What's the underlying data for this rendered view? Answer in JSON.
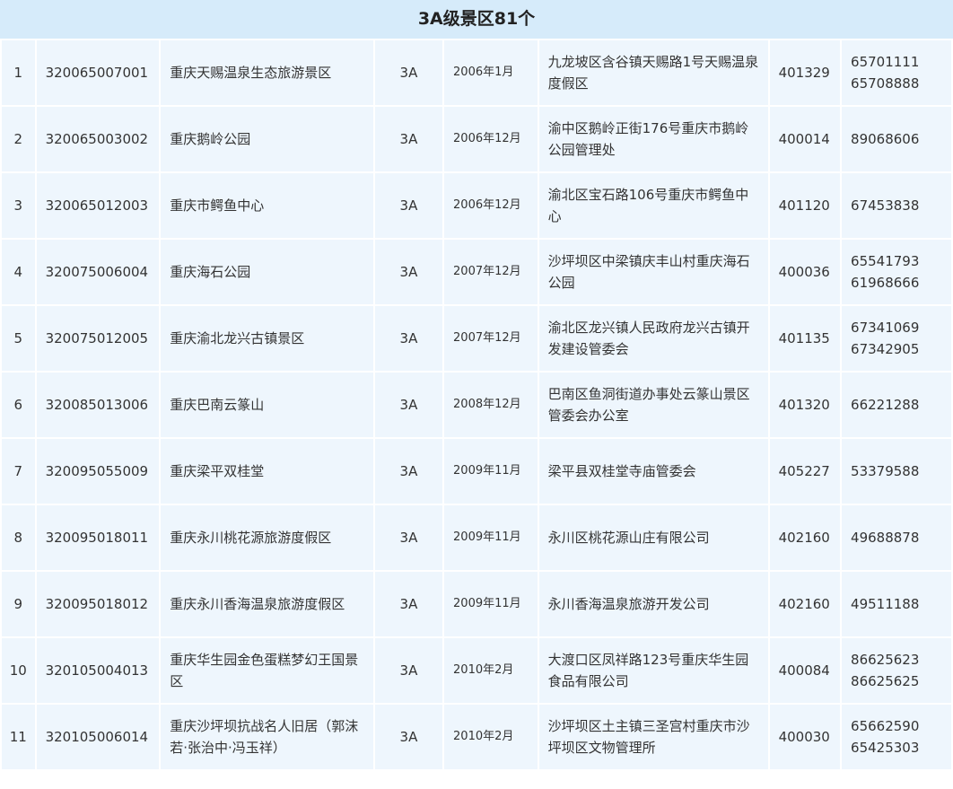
{
  "title": "3A级景区81个",
  "rows": [
    {
      "no": "1",
      "code": "320065007001",
      "name": "重庆天赐温泉生态旅游景区",
      "level": "3A",
      "date": "2006年1月",
      "address": "九龙坡区含谷镇天赐路1号天赐温泉度假区",
      "zip": "401329",
      "phone": "65701111 65708888"
    },
    {
      "no": "2",
      "code": "320065003002",
      "name": "重庆鹅岭公园",
      "level": "3A",
      "date": "2006年12月",
      "address": "渝中区鹅岭正街176号重庆市鹅岭公园管理处",
      "zip": "400014",
      "phone": "89068606"
    },
    {
      "no": "3",
      "code": "320065012003",
      "name": "重庆市鳄鱼中心",
      "level": "3A",
      "date": "2006年12月",
      "address": "渝北区宝石路106号重庆市鳄鱼中心",
      "zip": "401120",
      "phone": "67453838"
    },
    {
      "no": "4",
      "code": "320075006004",
      "name": "重庆海石公园",
      "level": "3A",
      "date": "2007年12月",
      "address": "沙坪坝区中梁镇庆丰山村重庆海石公园",
      "zip": "400036",
      "phone": "65541793 61968666"
    },
    {
      "no": "5",
      "code": "320075012005",
      "name": "重庆渝北龙兴古镇景区",
      "level": "3A",
      "date": "2007年12月",
      "address": "渝北区龙兴镇人民政府龙兴古镇开发建设管委会",
      "zip": "401135",
      "phone": "67341069 67342905"
    },
    {
      "no": "6",
      "code": "320085013006",
      "name": "重庆巴南云篆山",
      "level": "3A",
      "date": "2008年12月",
      "address": "巴南区鱼洞街道办事处云篆山景区管委会办公室",
      "zip": "401320",
      "phone": "66221288"
    },
    {
      "no": "7",
      "code": "320095055009",
      "name": "重庆梁平双桂堂",
      "level": "3A",
      "date": "2009年11月",
      "address": "梁平县双桂堂寺庙管委会",
      "zip": "405227",
      "phone": "53379588"
    },
    {
      "no": "8",
      "code": "320095018011",
      "name": "重庆永川桃花源旅游度假区",
      "level": "3A",
      "date": "2009年11月",
      "address": "永川区桃花源山庄有限公司",
      "zip": "402160",
      "phone": "49688878"
    },
    {
      "no": "9",
      "code": "320095018012",
      "name": "重庆永川香海温泉旅游度假区",
      "level": "3A",
      "date": "2009年11月",
      "address": "永川香海温泉旅游开发公司",
      "zip": "402160",
      "phone": "49511188"
    },
    {
      "no": "10",
      "code": "320105004013",
      "name": "重庆华生园金色蛋糕梦幻王国景区",
      "level": "3A",
      "date": "2010年2月",
      "address": "大渡口区凤祥路123号重庆华生园食品有限公司",
      "zip": "400084",
      "phone": "86625623 86625625"
    },
    {
      "no": "11",
      "code": "320105006014",
      "name": "重庆沙坪坝抗战名人旧居（郭沫若·张治中·冯玉祥）",
      "level": "3A",
      "date": "2010年2月",
      "address": "沙坪坝区土主镇三圣宫村重庆市沙坪坝区文物管理所",
      "zip": "400030",
      "phone": "65662590 65425303"
    }
  ]
}
